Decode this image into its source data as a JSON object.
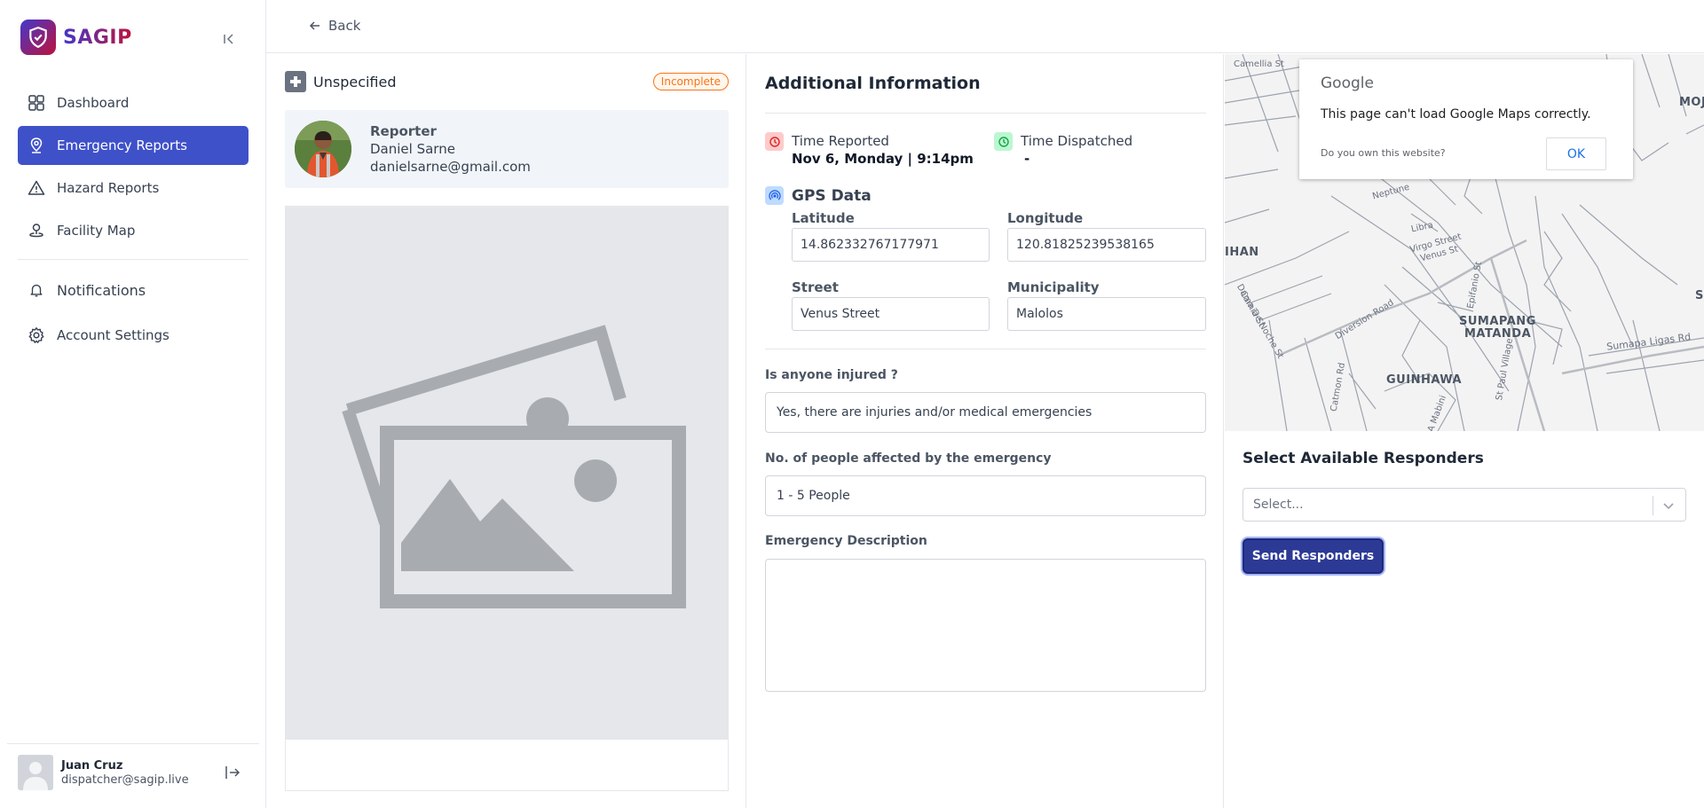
{
  "brand": {
    "name": "SAGIP"
  },
  "sidebar": {
    "items": [
      {
        "label": "Dashboard",
        "icon": "grid-icon"
      },
      {
        "label": "Emergency Reports",
        "icon": "location-pin-icon",
        "active": true
      },
      {
        "label": "Hazard Reports",
        "icon": "warning-triangle-icon"
      },
      {
        "label": "Facility Map",
        "icon": "map-marker-icon"
      }
    ],
    "secondary": [
      {
        "label": "Notifications",
        "icon": "bell-icon"
      },
      {
        "label": "Account Settings",
        "icon": "gear-icon"
      }
    ],
    "user": {
      "name": "Juan Cruz",
      "email": "dispatcher@sagip.live"
    }
  },
  "topbar": {
    "back_label": "Back"
  },
  "report": {
    "type": "Unspecified",
    "status": "Incomplete",
    "reporter": {
      "title": "Reporter",
      "name": "Daniel Sarne",
      "email": "danielsarne@gmail.com"
    }
  },
  "info": {
    "title": "Additional Information",
    "time_reported_label": "Time Reported",
    "time_reported_value": "Nov 6, Monday | 9:14pm",
    "time_dispatched_label": "Time Dispatched",
    "time_dispatched_value": "-",
    "gps_title": "GPS Data",
    "latitude_label": "Latitude",
    "latitude": "14.862332767177971",
    "longitude_label": "Longitude",
    "longitude": "120.81825239538165",
    "street_label": "Street",
    "street": "Venus Street",
    "municipality_label": "Municipality",
    "municipality": "Malolos",
    "injured_label": "Is anyone injured ?",
    "injured": "Yes, there are injuries and/or medical emergencies",
    "affected_label": "No. of people affected by the emergency",
    "affected": "1 - 5 People",
    "description_label": "Emergency Description",
    "description": ""
  },
  "map": {
    "dialog_brand": "Google",
    "message": "This page can't load Google Maps correctly.",
    "own_question": "Do you own this website?",
    "ok_label": "OK",
    "labels": {
      "sumapang": "SUMAPANG",
      "matanda": "MATANDA",
      "guinhawa": "GUINHAWA",
      "ihan": "IHAN",
      "moj": "MOJ",
      "s": "S"
    },
    "roads": {
      "camellia": "Camellia St",
      "diversion": "Diversion Road",
      "sumapa_ligas": "Sumapa Ligas Rd",
      "catmon": "Catmon Rd",
      "st_paul": "St Paul Village",
      "libra": "Libra",
      "virgo": "Virgo Street",
      "venus": "Venus St",
      "neptune": "Neptune",
      "a_mabini": "A Mabini",
      "epifanio": "Epifanio St",
      "camia": "Camia St",
      "dama": "Dama De Noche St"
    }
  },
  "responders": {
    "title": "Select Available Responders",
    "placeholder": "Select...",
    "send_label": "Send Responders"
  }
}
